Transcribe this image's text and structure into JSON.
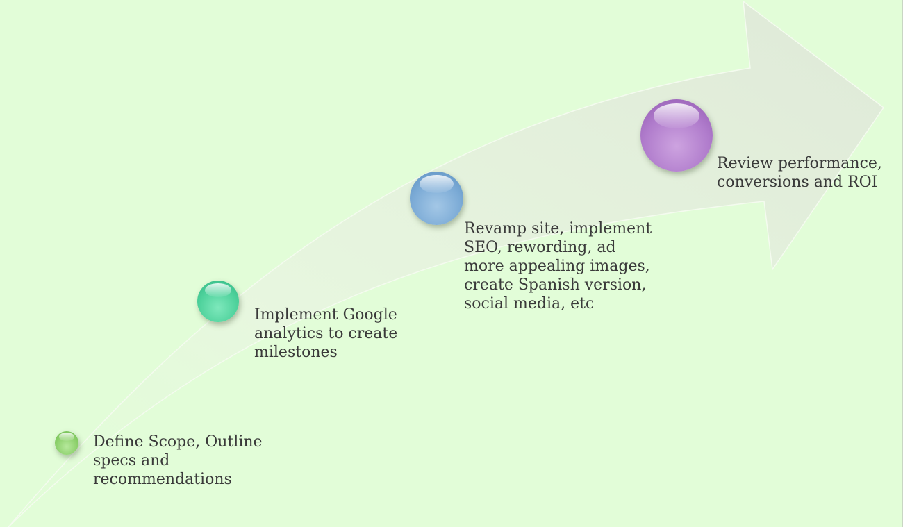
{
  "diagram": {
    "steps": [
      {
        "label": "Define Scope, Outline\nspecs and\nrecommendations",
        "color": "#8cd06b"
      },
      {
        "label": "Implement Google\nanalytics to create\nmilestones",
        "color": "#4fd29c"
      },
      {
        "label": "Revamp site, implement\nSEO, rewording, ad\nmore appealing images,\ncreate Spanish version,\nsocial media, etc",
        "color": "#7cabd6"
      },
      {
        "label": "Review performance,\nconversions and ROI",
        "color": "#b07ccc"
      }
    ],
    "background_color": "#e2fdd8",
    "arrow_color": "#e4efdc"
  }
}
